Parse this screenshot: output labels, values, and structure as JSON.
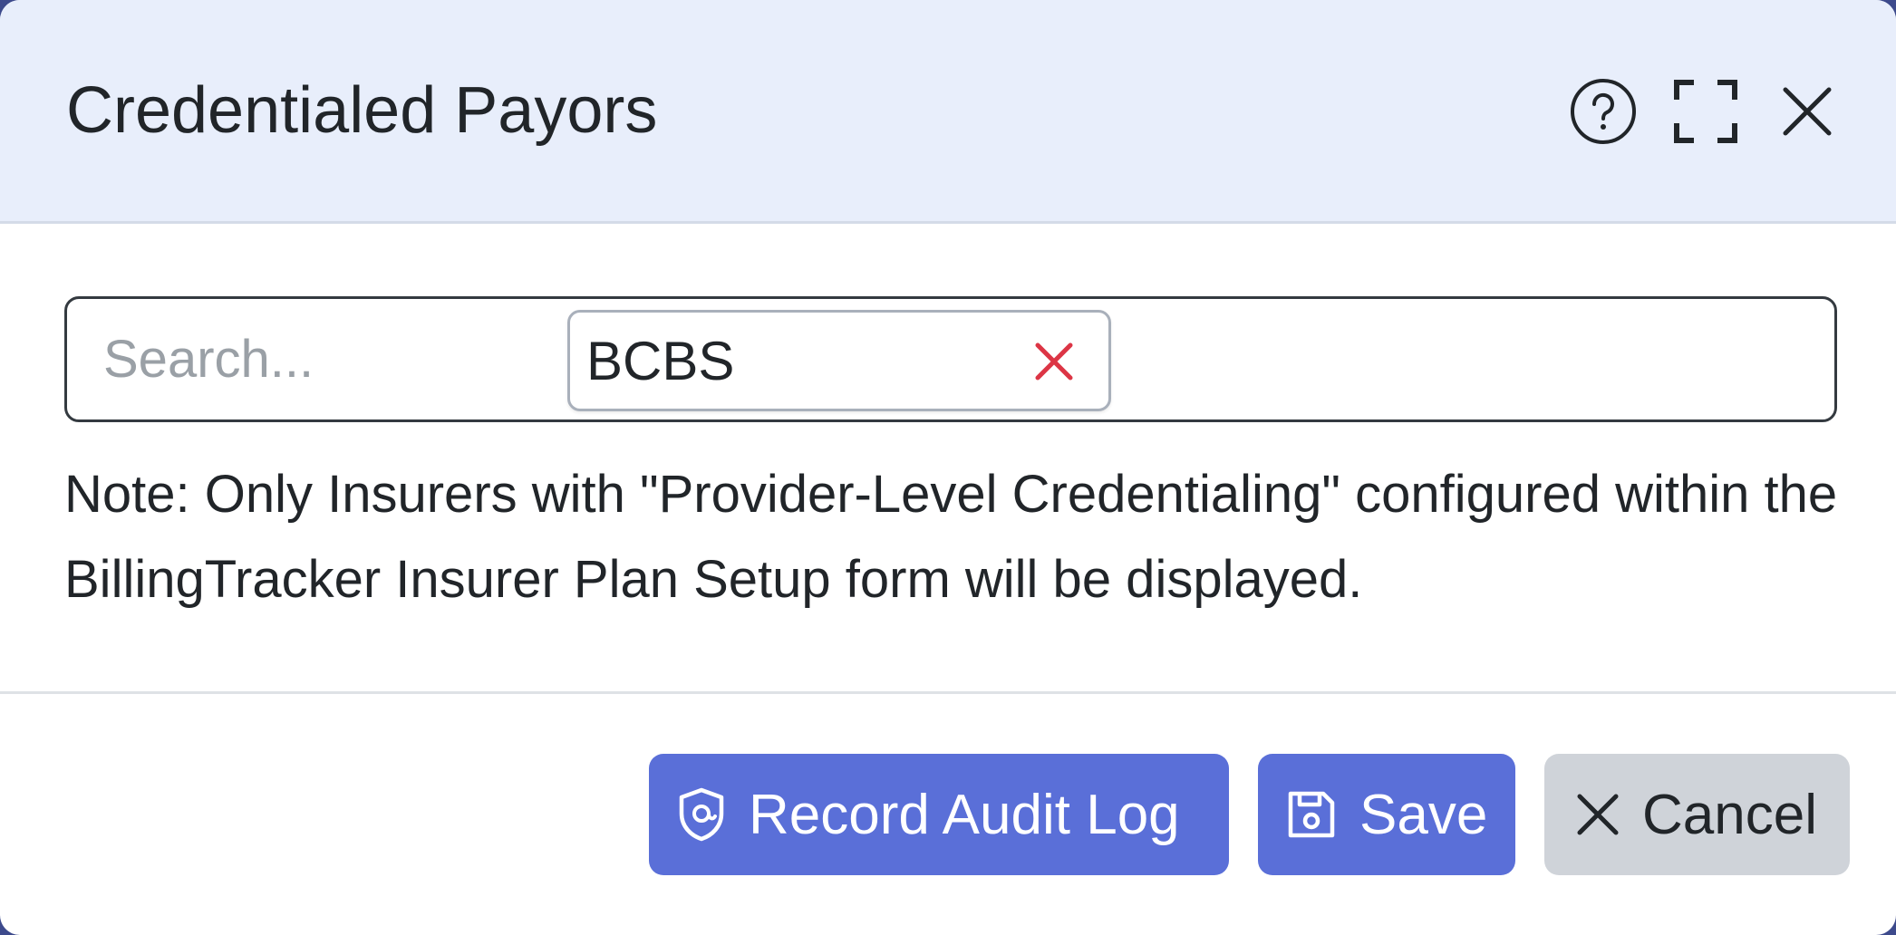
{
  "dialog": {
    "title": "Credentialed Payors",
    "header_icons": [
      "help-icon",
      "expand-icon",
      "close-icon"
    ]
  },
  "search": {
    "placeholder": "Search...",
    "value": "",
    "selected_tags": [
      {
        "label": "BCBS"
      }
    ]
  },
  "note": "Note: Only Insurers with \"Provider-Level Credentialing\" configured within the BillingTracker Insurer Plan Setup form will be displayed.",
  "footer": {
    "record_audit_log_label": "Record Audit Log",
    "save_label": "Save",
    "cancel_label": "Cancel"
  },
  "colors": {
    "header_bg": "#e8eefb",
    "primary": "#5a6fd8",
    "secondary": "#cfd3d9",
    "tag_remove": "#dc3545"
  }
}
